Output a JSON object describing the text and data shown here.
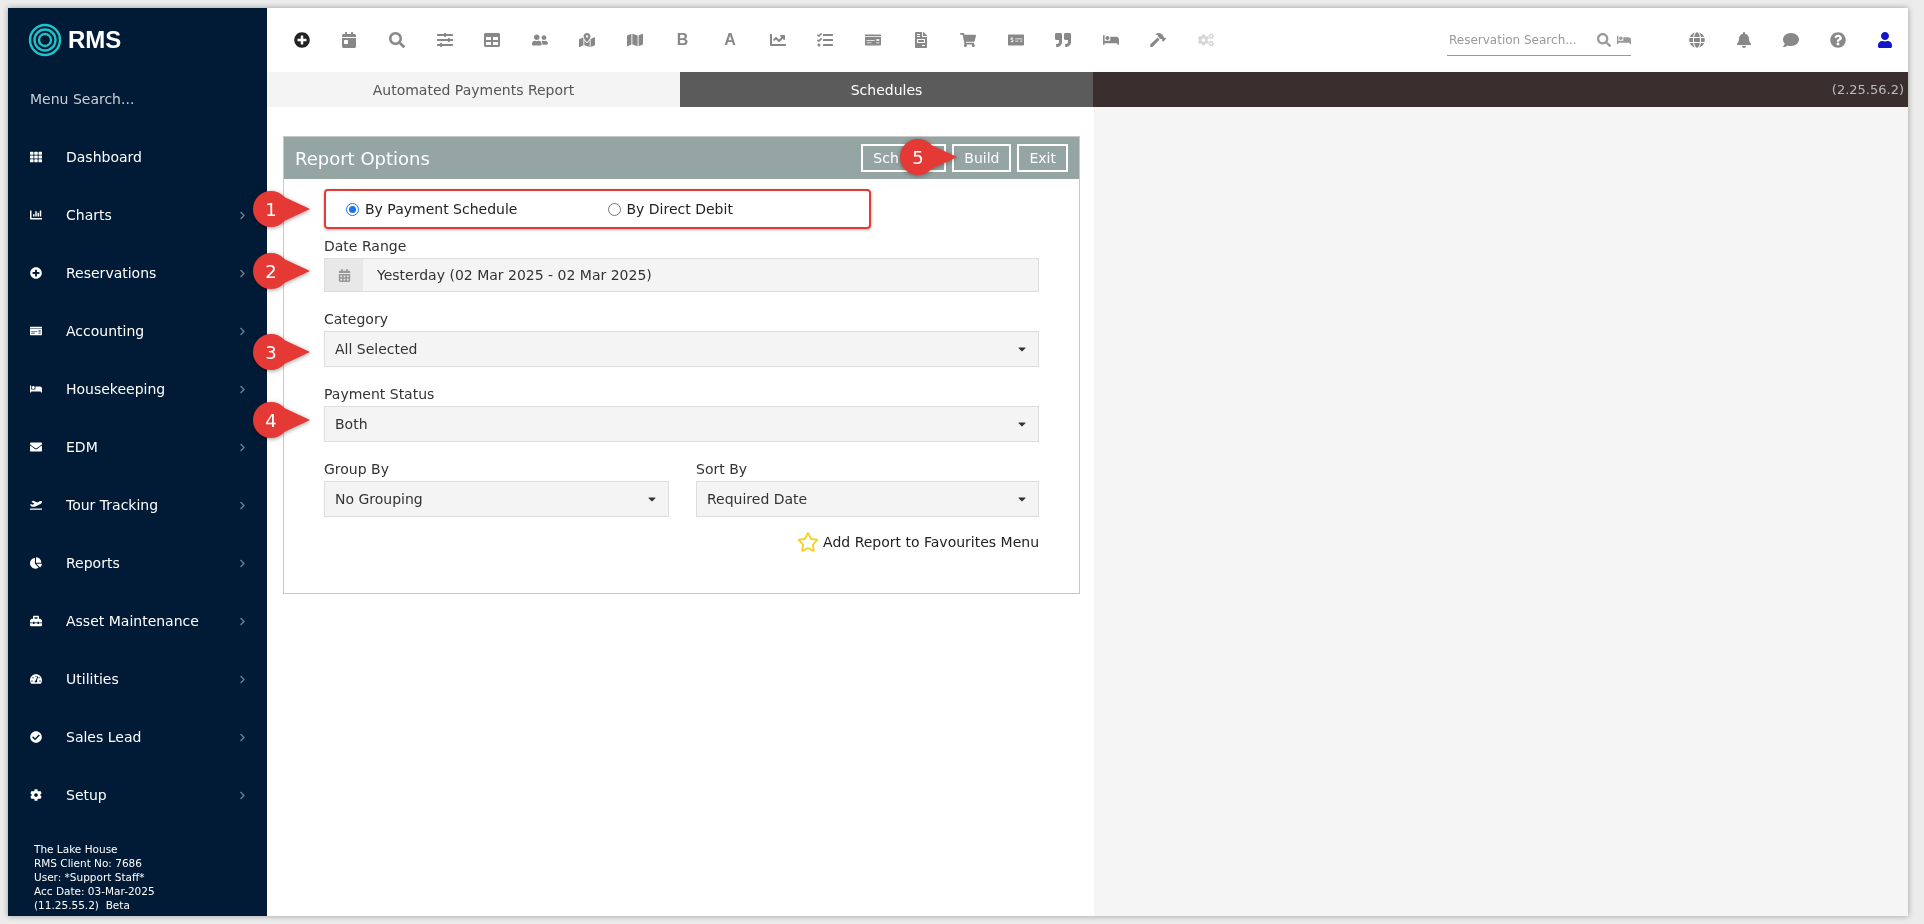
{
  "brand": {
    "name": "RMS"
  },
  "sidebar": {
    "search_placeholder": "Menu Search...",
    "items": [
      {
        "label": "Dashboard",
        "expandable": false
      },
      {
        "label": "Charts",
        "expandable": true
      },
      {
        "label": "Reservations",
        "expandable": true
      },
      {
        "label": "Accounting",
        "expandable": true
      },
      {
        "label": "Housekeeping",
        "expandable": true
      },
      {
        "label": "EDM",
        "expandable": true
      },
      {
        "label": "Tour Tracking",
        "expandable": true
      },
      {
        "label": "Reports",
        "expandable": true
      },
      {
        "label": "Asset Maintenance",
        "expandable": true
      },
      {
        "label": "Utilities",
        "expandable": true
      },
      {
        "label": "Sales Lead",
        "expandable": true
      },
      {
        "label": "Setup",
        "expandable": true
      }
    ],
    "footer": [
      "The Lake House",
      "RMS Client No: 7686",
      "User: *Support Staff*",
      "Acc Date: 03-Mar-2025",
      "(11.25.55.2)  Beta"
    ]
  },
  "toolbar": {
    "items": [
      {
        "kind": "icon",
        "disabled": false
      },
      {
        "kind": "icon",
        "disabled": false
      },
      {
        "kind": "icon",
        "disabled": false
      },
      {
        "kind": "icon",
        "disabled": false
      },
      {
        "kind": "icon",
        "disabled": false
      },
      {
        "kind": "icon",
        "disabled": false
      },
      {
        "kind": "icon",
        "disabled": false
      },
      {
        "kind": "icon",
        "disabled": false
      },
      {
        "kind": "letter",
        "text": "B",
        "disabled": false
      },
      {
        "kind": "letter",
        "text": "A",
        "disabled": false
      },
      {
        "kind": "icon",
        "disabled": false
      },
      {
        "kind": "icon",
        "disabled": false
      },
      {
        "kind": "icon",
        "disabled": false
      },
      {
        "kind": "icon",
        "disabled": false
      },
      {
        "kind": "icon",
        "disabled": false
      },
      {
        "kind": "icon",
        "disabled": false
      },
      {
        "kind": "icon",
        "disabled": false
      },
      {
        "kind": "icon",
        "disabled": false
      },
      {
        "kind": "icon",
        "disabled": false
      },
      {
        "kind": "icon",
        "disabled": true
      }
    ],
    "reservation_search": {
      "placeholder": "Reservation Search..."
    }
  },
  "tabs": [
    {
      "label": "Automated Payments Report",
      "selected": false
    },
    {
      "label": "Schedules",
      "selected": true
    }
  ],
  "version": "(2.25.56.2)",
  "report_options": {
    "title": "Report Options",
    "buttons": [
      "Sch",
      "Build",
      "Exit"
    ],
    "report_type": [
      {
        "label": "By Payment Schedule",
        "selected": true
      },
      {
        "label": "By Direct Debit",
        "selected": false
      }
    ],
    "fields": [
      {
        "label": "Date Range",
        "kind": "date",
        "value": "Yesterday (02 Mar 2025 - 02 Mar 2025)"
      },
      {
        "label": "Category",
        "kind": "select",
        "value": "All Selected"
      },
      {
        "label": "Payment Status",
        "kind": "select",
        "value": "Both"
      }
    ],
    "field_pair": [
      {
        "label": "Group By",
        "kind": "select",
        "value": "No Grouping"
      },
      {
        "label": "Sort By",
        "kind": "select",
        "value": "Required Date"
      }
    ],
    "favourite": {
      "label": "Add Report to Favourites Menu"
    }
  },
  "annotations": [
    {
      "number": "1"
    },
    {
      "number": "2"
    },
    {
      "number": "3"
    },
    {
      "number": "4"
    },
    {
      "number": "5"
    }
  ]
}
